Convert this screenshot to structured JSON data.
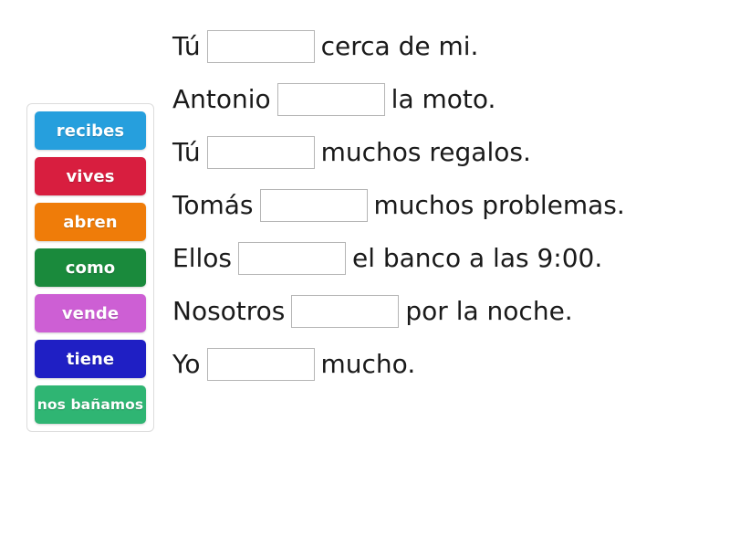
{
  "word_bank": {
    "name": "word-bank",
    "tiles": [
      {
        "label": "recibes",
        "color": "#269fdd"
      },
      {
        "label": "vives",
        "color": "#d81e3f"
      },
      {
        "label": "abren",
        "color": "#ef7c09"
      },
      {
        "label": "como",
        "color": "#1a8a3c"
      },
      {
        "label": "vende",
        "color": "#cd5fd4"
      },
      {
        "label": "tiene",
        "color": "#1f1fc4"
      },
      {
        "label": "nos bañamos",
        "color": "#2fb573"
      }
    ]
  },
  "sentences": [
    {
      "id": "sentence-1",
      "before": "Tú",
      "blank_width": 118,
      "after": "cerca de mi."
    },
    {
      "id": "sentence-2",
      "before": "Antonio",
      "blank_width": 118,
      "after": "la moto."
    },
    {
      "id": "sentence-3",
      "before": "Tú",
      "blank_width": 118,
      "after": "muchos regalos."
    },
    {
      "id": "sentence-4",
      "before": "Tomás",
      "blank_width": 118,
      "after": "muchos problemas."
    },
    {
      "id": "sentence-5",
      "before": "Ellos",
      "blank_width": 118,
      "after": "el banco a las 9:00."
    },
    {
      "id": "sentence-6",
      "before": "Nosotros",
      "blank_width": 118,
      "after": "por la noche."
    },
    {
      "id": "sentence-7",
      "before": "Yo",
      "blank_width": 118,
      "after": "mucho."
    }
  ]
}
